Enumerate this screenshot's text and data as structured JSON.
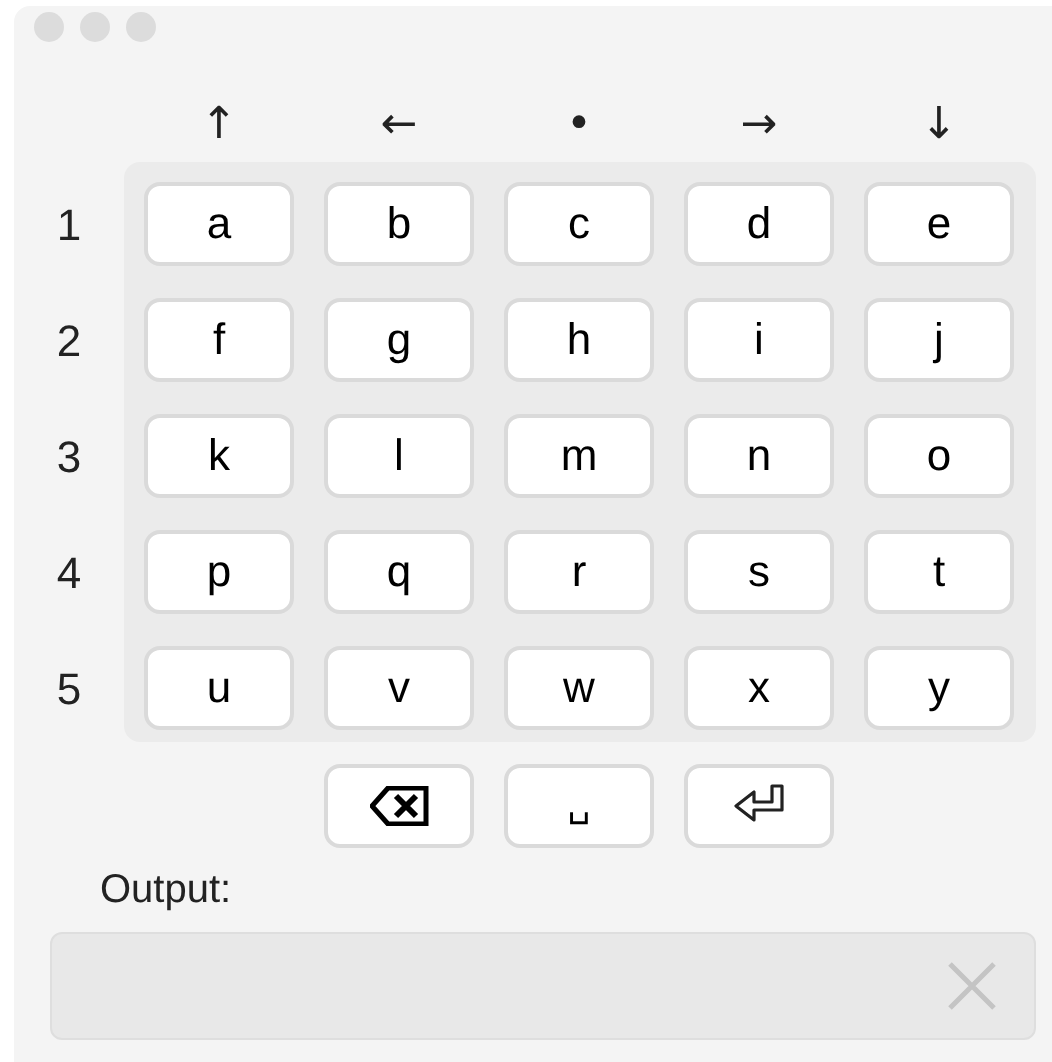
{
  "column_headers": [
    "↑",
    "←",
    "•",
    "→",
    "↓"
  ],
  "rows": [
    {
      "label": "1",
      "keys": [
        "a",
        "b",
        "c",
        "d",
        "e"
      ]
    },
    {
      "label": "2",
      "keys": [
        "f",
        "g",
        "h",
        "i",
        "j"
      ]
    },
    {
      "label": "3",
      "keys": [
        "k",
        "l",
        "m",
        "n",
        "o"
      ]
    },
    {
      "label": "4",
      "keys": [
        "p",
        "q",
        "r",
        "s",
        "t"
      ]
    },
    {
      "label": "5",
      "keys": [
        "u",
        "v",
        "w",
        "x",
        "y"
      ]
    }
  ],
  "action_keys": [
    {
      "kind": "backspace"
    },
    {
      "kind": "space",
      "text": "␣"
    },
    {
      "kind": "return"
    }
  ],
  "output": {
    "label": "Output:"
  }
}
